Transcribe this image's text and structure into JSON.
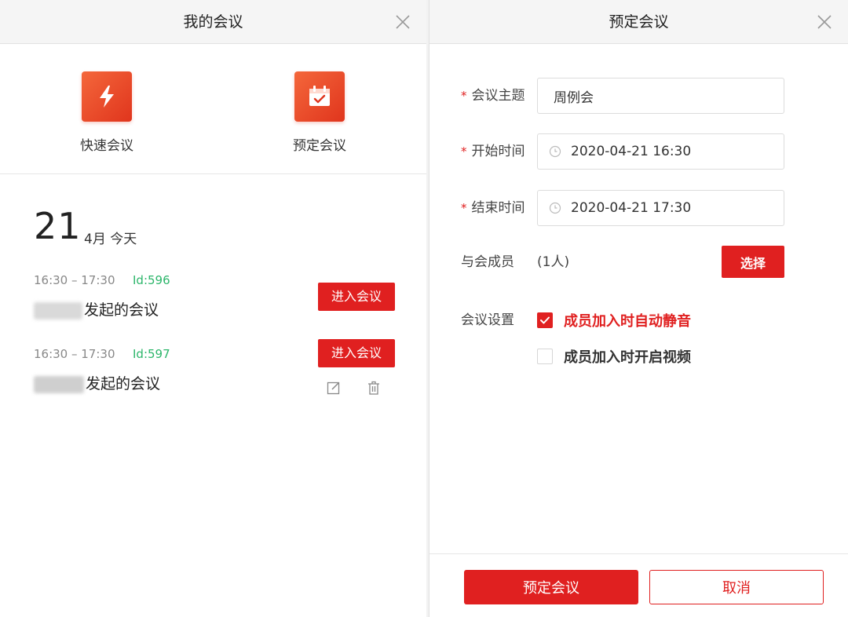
{
  "left": {
    "title": "我的会议",
    "actions": {
      "quick": {
        "label": "快速会议",
        "icon": "lightning-icon"
      },
      "schedule": {
        "label": "预定会议",
        "icon": "calendar-check-icon"
      }
    },
    "date": {
      "day": "21",
      "month_label": "4月 今天"
    },
    "meetings": [
      {
        "time": "16:30 – 17:30",
        "id": "Id:596",
        "title_suffix": "发起的会议",
        "enter_label": "进入会议"
      },
      {
        "time": "16:30 – 17:30",
        "id": "Id:597",
        "title_suffix": "发起的会议",
        "enter_label": "进入会议"
      }
    ]
  },
  "right": {
    "title": "预定会议",
    "fields": {
      "topic": {
        "label": "会议主题",
        "value": "周例会"
      },
      "start": {
        "label": "开始时间",
        "value": "2020-04-21 16:30"
      },
      "end": {
        "label": "结束时间",
        "value": "2020-04-21 17:30"
      }
    },
    "members": {
      "label": "与会成员",
      "count": "(1人)",
      "select_label": "选择"
    },
    "settings": {
      "label": "会议设置",
      "options": [
        {
          "label": "成员加入时自动静音",
          "checked": true
        },
        {
          "label": "成员加入时开启视频",
          "checked": false
        }
      ]
    },
    "footer": {
      "submit_label": "预定会议",
      "cancel_label": "取消"
    }
  },
  "colors": {
    "accent": "#e02020",
    "id_green": "#2db66b",
    "icon_orange": "#f4673b"
  }
}
